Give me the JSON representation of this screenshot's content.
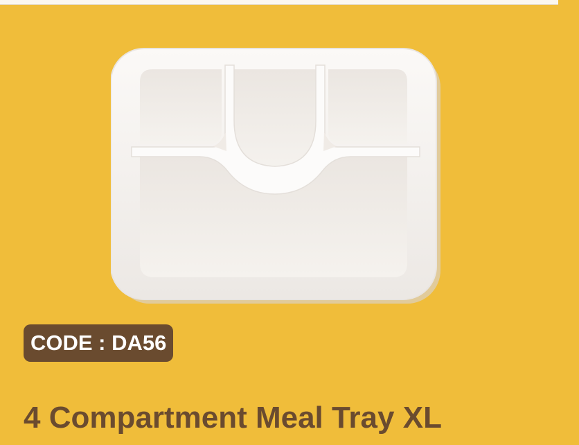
{
  "product": {
    "code_label": "CODE : DA56",
    "title": "4 Compartment Meal Tray XL",
    "image_subject": "4-compartment-meal-tray"
  },
  "colors": {
    "background": "#f0bd3a",
    "badge_background": "#6a4b2f",
    "badge_text": "#ffffff",
    "title_text": "#6a4b2f",
    "tray": "#f8f5f2"
  }
}
